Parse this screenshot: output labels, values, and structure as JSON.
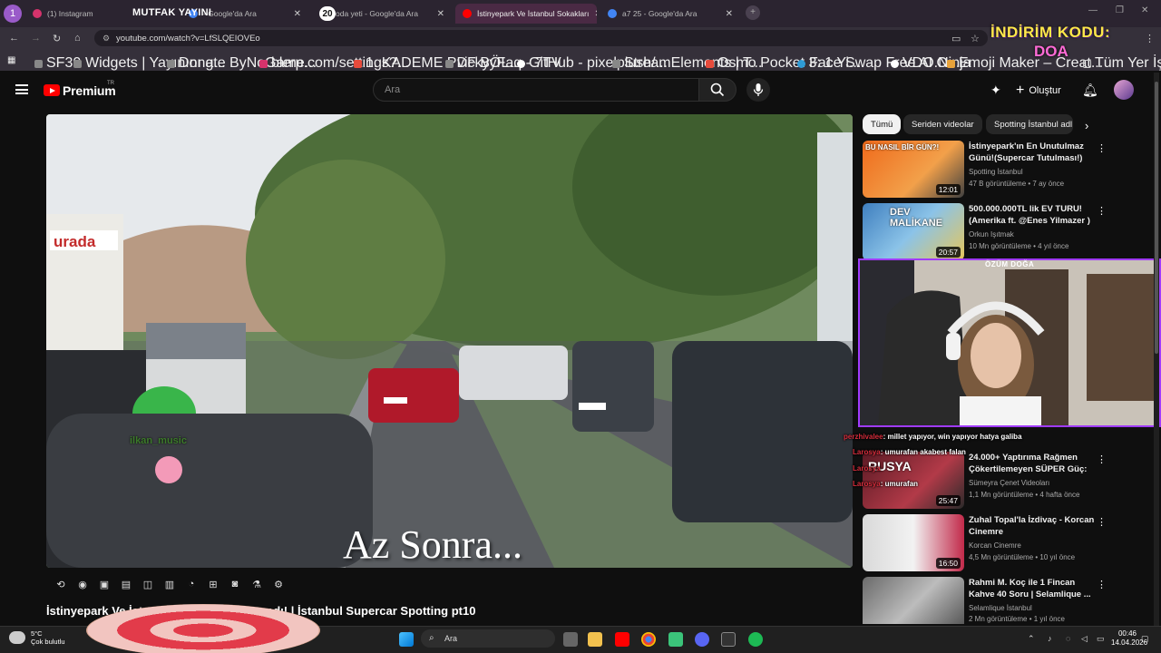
{
  "browser": {
    "tabs": [
      {
        "label": "(1) Instagram"
      },
      {
        "label": "- Google'da Ara"
      },
      {
        "label": "oda yeti - Google'da Ara"
      },
      {
        "label": "İstinyepark Ve İstanbul Sokakları"
      },
      {
        "label": "a7 25 - Google'da Ara"
      }
    ],
    "overlay_title": "MUTFAK YAYINI",
    "overlay_count": "20",
    "profile_number": "1",
    "url": "youtube.com/watch?v=LfSLQEIOVEo",
    "bookmarks": [
      "SF30",
      "Widgets | Yayınını g...",
      "Donate ByNoGame...",
      "blerp.com/settings?...",
      "1. KADEME PDF BÖL...",
      "vickyyFaq - 7TV",
      "GitHub - pixelplush/...",
      "StreamElements | T...",
      "Osmo Pocket 3: 1 Yi...",
      "Face Swap Free AI O...",
      "VDO.Ninja",
      "Emoji Maker – Creat..."
    ],
    "all_bookmarks": "Tüm Yer İşaretleri"
  },
  "stream_overlay": {
    "promo_line1": "İNDİRİM KODU:",
    "promo_line2": "DOA",
    "cam_name": "ÖZÜM DOĞA",
    "player_username": "ilkan_music"
  },
  "youtube": {
    "logo_text": "Premium",
    "logo_region": "TR",
    "search_placeholder": "Ara",
    "create_label": "Oluştur",
    "video_caption": "Az Sonra...",
    "video_title": "İstinyepark Ve İstanbul Sokakları Aratmadı! | İstanbul Supercar Spotting pt10",
    "chips": [
      "Tümü",
      "Seriden videolar",
      "Spotting İstanbul adlı"
    ],
    "recommendations": [
      {
        "title": "İstinyepark'ın En Unutulmaz Günü!(Supercar Tutulması!)",
        "channel": "Spotting İstanbul",
        "meta": "47 B görüntüleme • 7 ay önce",
        "duration": "12:01",
        "thumb_text": "BU NASIL BİR GÜN?!"
      },
      {
        "title": "500.000.000TL lik EV TURU! (Amerika ft. @Enes Yilmazer )",
        "channel": "Orkun Işıtmak",
        "meta": "10 Mn görüntüleme • 4 yıl önce",
        "duration": "20:57",
        "thumb_text": "DEV MALİKANE"
      },
      {
        "title": "24.000+ Yaptırıma Rağmen Çökertilemeyen SÜPER Güç: ...",
        "channel": "Sümeyra Çenet Videoları",
        "meta": "1,1 Mn görüntüleme • 4 hafta önce",
        "duration": "25:47",
        "thumb_text": "RUSYA"
      },
      {
        "title": "Zuhal Topal'la İzdivaç - Korcan Cinemre",
        "channel": "Korcan Cinemre",
        "meta": "4,5 Mn görüntüleme • 10 yıl önce",
        "duration": "16:50",
        "thumb_text": ""
      },
      {
        "title": "Rahmi M. Koç ile 1 Fincan Kahve 40 Soru | Selamlique ...",
        "channel": "Selamlique İstanbul",
        "meta": "2 Mn görüntüleme • 1 yıl önce",
        "duration": "",
        "thumb_text": ""
      }
    ]
  },
  "chat": [
    {
      "user": "perzhivalee",
      "text": ": millet yapıyor, win yapıyor hatya galiba"
    },
    {
      "user": "Larosya",
      "text": ": umurafan akabest falan"
    },
    {
      "user": "Larosya",
      "text": ""
    },
    {
      "user": "Larosya",
      "text": ": umurafan"
    }
  ],
  "taskbar": {
    "weather_temp": "5°C",
    "weather_desc": "Çok bulutlu",
    "search_placeholder": "Ara",
    "time": "00:46",
    "date": "14.04.2026"
  },
  "colors": {
    "yt_red": "#ff0000",
    "cam_border": "#a03bff",
    "promo_yellow": "#ffe94a"
  }
}
